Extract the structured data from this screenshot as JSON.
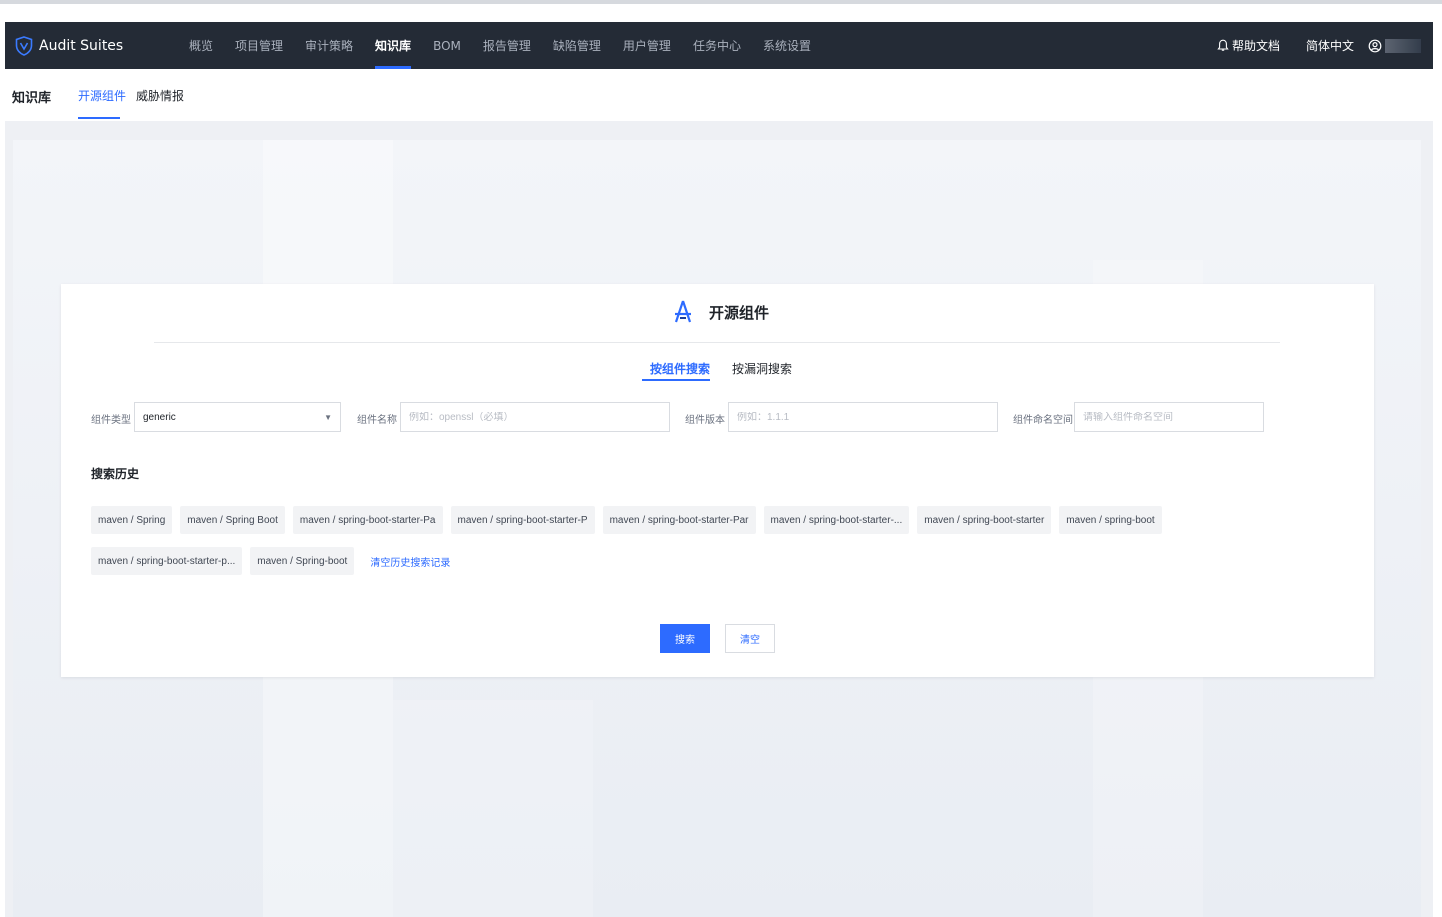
{
  "app": {
    "brand": "Audit Suites",
    "nav": [
      {
        "label": "概览"
      },
      {
        "label": "项目管理"
      },
      {
        "label": "审计策略"
      },
      {
        "label": "知识库"
      },
      {
        "label": "BOM"
      },
      {
        "label": "报告管理"
      },
      {
        "label": "缺陷管理"
      },
      {
        "label": "用户管理"
      },
      {
        "label": "任务中心"
      },
      {
        "label": "系统设置"
      }
    ],
    "active_nav": "知识库",
    "help_label": "帮助文档",
    "language": "简体中文",
    "accent_color": "#2d6bff",
    "navbar_color": "#242b36"
  },
  "subheader": {
    "title": "知识库",
    "tabs": [
      {
        "label": "开源组件",
        "active": true
      },
      {
        "label": "威胁情报",
        "active": false
      }
    ]
  },
  "card": {
    "title": "开源组件",
    "icon": "component-logo-icon",
    "modes": [
      {
        "label": "按组件搜索",
        "active": true
      },
      {
        "label": "按漏洞搜索",
        "active": false
      }
    ],
    "fields": {
      "type_label": "组件类型",
      "type_value": "generic",
      "name_label": "组件名称",
      "name_placeholder": "例如：openssl（必填）",
      "version_label": "组件版本",
      "version_placeholder": "例如：1.1.1",
      "namespace_label": "组件命名空间",
      "namespace_placeholder": "请输入组件命名空间"
    },
    "history_title": "搜索历史",
    "history": [
      "maven / Spring",
      "maven / Spring Boot",
      "maven / spring-boot-starter-Pa",
      "maven / spring-boot-starter-P",
      "maven / spring-boot-starter-Par",
      "maven / spring-boot-starter-...",
      "maven / spring-boot-starter",
      "maven / spring-boot",
      "maven / spring-boot-starter-p...",
      "maven / Spring-boot"
    ],
    "clear_history_label": "清空历史搜索记录",
    "search_button": "搜索",
    "clear_button": "清空"
  }
}
